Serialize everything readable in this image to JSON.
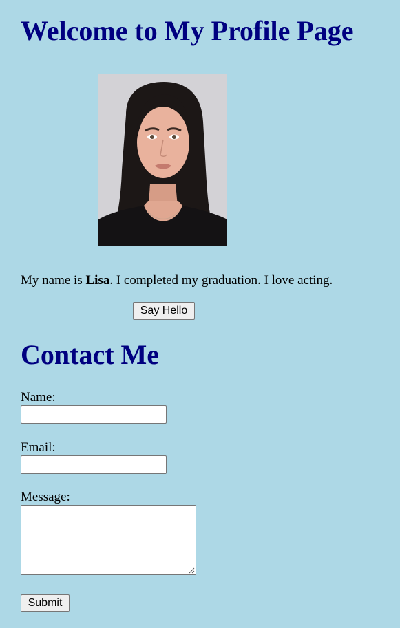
{
  "header": {
    "title": "Welcome to My Profile Page"
  },
  "profile": {
    "photo_icon": "portrait-photo",
    "bio_prefix": "My name is ",
    "name": "Lisa",
    "bio_suffix": ". I completed my graduation. I love acting.",
    "hello_button_label": "Say Hello"
  },
  "contact": {
    "title": "Contact Me",
    "name_label": "Name:",
    "name_value": "",
    "email_label": "Email:",
    "email_value": "",
    "message_label": "Message:",
    "message_value": "",
    "submit_label": "Submit"
  },
  "colors": {
    "background": "#add8e6",
    "heading": "#000080"
  }
}
